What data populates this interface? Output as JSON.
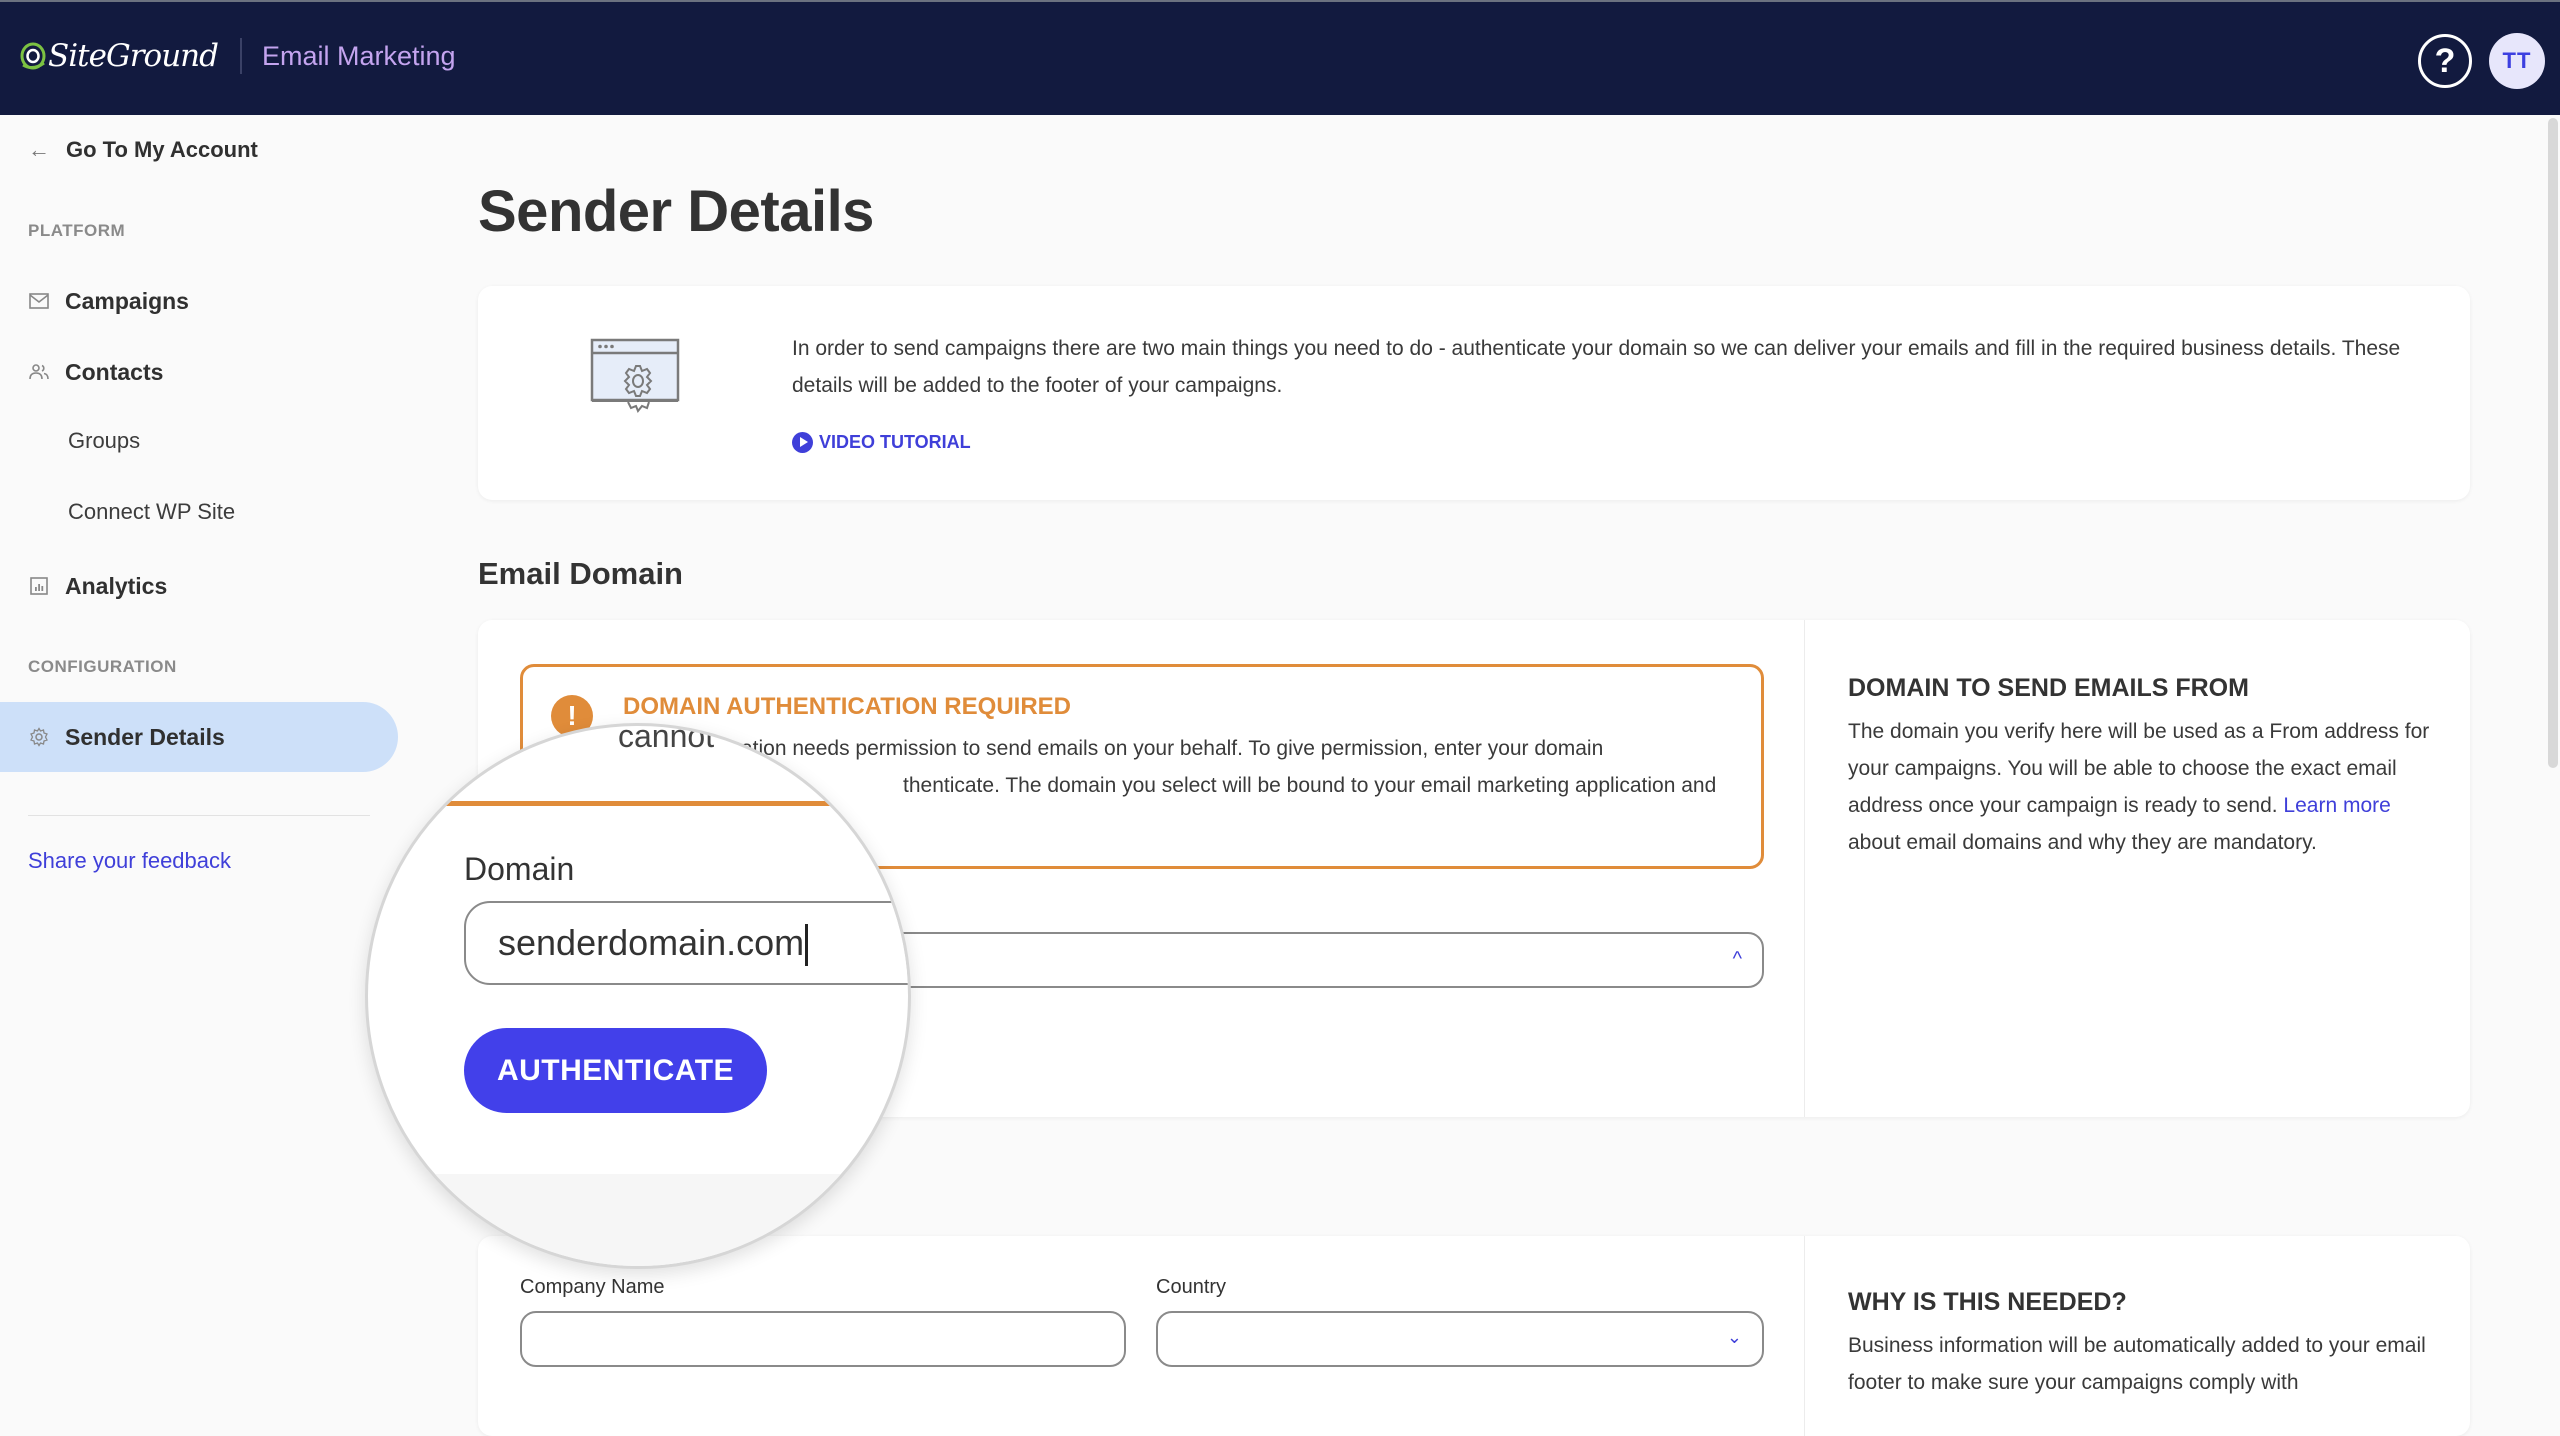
{
  "topbar": {
    "brand": "SiteGround",
    "app_name": "Email Marketing",
    "help_icon": "question-circle-icon",
    "avatar_initials": "TT"
  },
  "sidebar": {
    "back_link": "Go To My Account",
    "sections": [
      {
        "label": "PLATFORM"
      },
      {
        "label": "CONFIGURATION"
      }
    ],
    "items": [
      {
        "label": "Campaigns",
        "icon": "envelope-icon"
      },
      {
        "label": "Contacts",
        "icon": "users-icon"
      },
      {
        "label": "Groups"
      },
      {
        "label": "Connect WP Site"
      },
      {
        "label": "Analytics",
        "icon": "chart-icon"
      },
      {
        "label": "Sender Details",
        "icon": "gear-icon",
        "active": true
      }
    ],
    "feedback_link": "Share your feedback"
  },
  "main": {
    "title": "Sender Details",
    "intro": {
      "text": "In order to send campaigns there are two main things you need to do - authenticate your domain so we can deliver your emails and fill in the required business details. These details will be added to the footer of your campaigns.",
      "video_link": "VIDEO TUTORIAL"
    },
    "email_domain": {
      "section_title": "Email Domain",
      "warning": {
        "title": "DOMAIN AUTHENTICATION REQUIRED",
        "text": "Your email marketing application needs permission to send emails on your behalf. To give permission, enter your domain below and click Authenticate. The domain you select will be bound to your email marketing application and cannot be changed.",
        "visible_text": "ation needs permission to send emails on your behalf. To give permission, enter your domain",
        "visible_text_2": "thenticate. The domain you select will be bound to your email marketing application and"
      },
      "domain_label": "Domain",
      "domain_value": "senderdomain.com",
      "authenticate_button": "AUTHENTICATE",
      "help": {
        "title": "DOMAIN TO SEND EMAILS FROM",
        "text_before": "The domain you verify here will be used as a From address for your campaigns. You will be able to choose the exact email address once your campaign is ready to send. ",
        "link": "Learn more",
        "text_after": " about email domains and why they are mandatory."
      },
      "magnifier_overflow_text": "cannot"
    },
    "business": {
      "company_label": "Company Name",
      "company_value": "",
      "country_label": "Country",
      "country_value": "",
      "help": {
        "title": "WHY IS THIS NEEDED?",
        "text": "Business information will be automatically added to your email footer to make sure your campaigns comply with"
      }
    }
  },
  "colors": {
    "topbar_bg": "#121a3f",
    "accent": "#4240ea",
    "link": "#3f3fd9",
    "warning": "#e08c3a",
    "active_nav": "#cde0f9",
    "app_name": "#c4a4ef"
  }
}
